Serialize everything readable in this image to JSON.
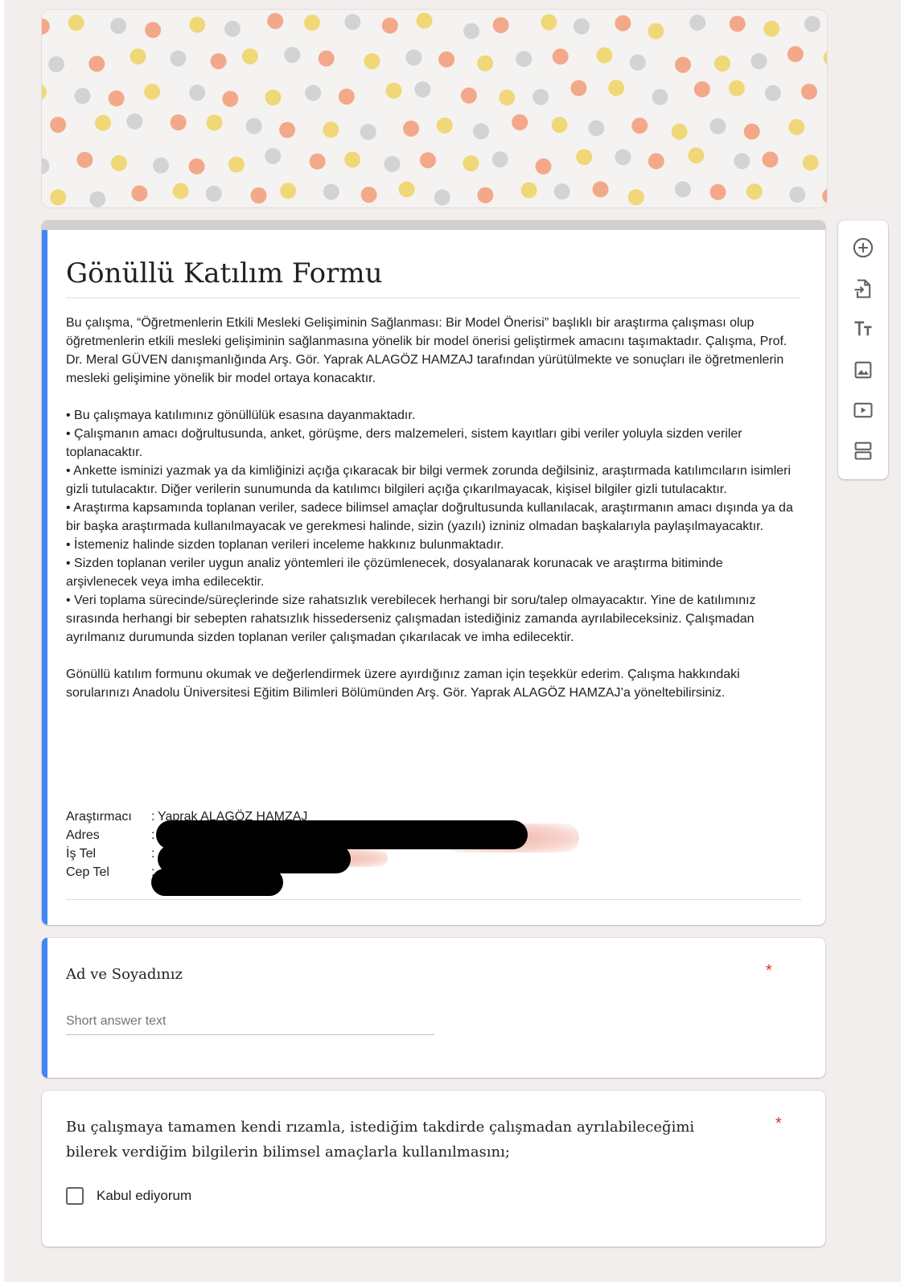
{
  "form": {
    "title": "Gönüllü Katılım Formu",
    "description": {
      "intro": "Bu çalışma, “Öğretmenlerin Etkili Mesleki Gelişiminin Sağlanması: Bir Model Önerisi” başlıklı bir araştırma çalışması olup öğretmenlerin etkili mesleki gelişiminin sağlanmasına yönelik bir model önerisi geliştirmek amacını taşımaktadır. Çalışma, Prof. Dr. Meral GÜVEN danışmanlığında Arş. Gör. Yaprak ALAGÖZ HAMZAJ tarafından yürütülmekte ve sonuçları ile öğretmenlerin mesleki gelişimine yönelik bir model ortaya konacaktır.",
      "bullets": [
        "• Bu çalışmaya katılımınız gönüllülük esasına dayanmaktadır.",
        "• Çalışmanın amacı doğrultusunda, anket, görüşme, ders malzemeleri, sistem kayıtları gibi veriler yoluyla sizden veriler toplanacaktır.",
        "• Ankette isminizi yazmak ya da kimliğinizi açığa çıkaracak bir bilgi vermek zorunda değilsiniz, araştırmada katılımcıların isimleri gizli tutulacaktır. Diğer verilerin sunumunda da katılımcı bilgileri açığa çıkarılmayacak, kişisel bilgiler gizli tutulacaktır.",
        "• Araştırma kapsamında toplanan veriler, sadece bilimsel amaçlar doğrultusunda kullanılacak, araştırmanın amacı dışında ya da bir başka araştırmada kullanılmayacak ve gerekmesi halinde, sizin (yazılı) izniniz olmadan başkalarıyla paylaşılmayacaktır.",
        "• İstemeniz halinde sizden toplanan verileri inceleme hakkınız bulunmaktadır.",
        "• Sizden toplanan veriler uygun analiz yöntemleri ile çözümlenecek, dosyalanarak korunacak ve araştırma bitiminde arşivlenecek veya imha edilecektir.",
        "• Veri toplama sürecinde/süreçlerinde size rahatsızlık verebilecek herhangi bir soru/talep olmayacaktır. Yine de katılımınız sırasında herhangi bir sebepten rahatsızlık hissederseniz çalışmadan istediğiniz zamanda ayrılabileceksiniz.  Çalışmadan ayrılmanız durumunda sizden toplanan veriler çalışmadan çıkarılacak ve imha edilecektir."
      ],
      "closing": "Gönüllü katılım formunu okumak ve değerlendirmek üzere ayırdığınız zaman için teşekkür ederim. Çalışma hakkındaki sorularınızı Anadolu Üniversitesi Eğitim Bilimleri Bölümünden Arş. Gör. Yaprak ALAGÖZ HAMZAJ’a yöneltebilirsiniz."
    },
    "contact": {
      "researcher_label": "Araştırmacı",
      "researcher_value": "Yaprak ALAGÖZ HAMZAJ",
      "address_label": "Adres",
      "work_phone_label": "İş Tel",
      "mobile_label": "Cep Tel",
      "separator": ":"
    }
  },
  "questions": [
    {
      "title": "Ad ve Soyadınız",
      "required_mark": "*",
      "placeholder": "Short answer text"
    },
    {
      "title": "Bu çalışmaya tamamen kendi rızamla, istediğim takdirde çalışmadan ayrılabileceğimi bilerek verdiğim bilgilerin bilimsel amaçlarla kullanılmasını;",
      "required_mark": "*",
      "option": "Kabul ediyorum"
    }
  ],
  "toolbar": {
    "items": [
      "add-question",
      "import-questions",
      "add-title-description",
      "add-image",
      "add-video",
      "add-section"
    ]
  },
  "colors": {
    "accent": "#4285f4",
    "required": "#d93025",
    "dot_orange": "#f4a07e",
    "dot_yellow": "#f0d56a",
    "dot_gray": "#cfcfcf"
  }
}
